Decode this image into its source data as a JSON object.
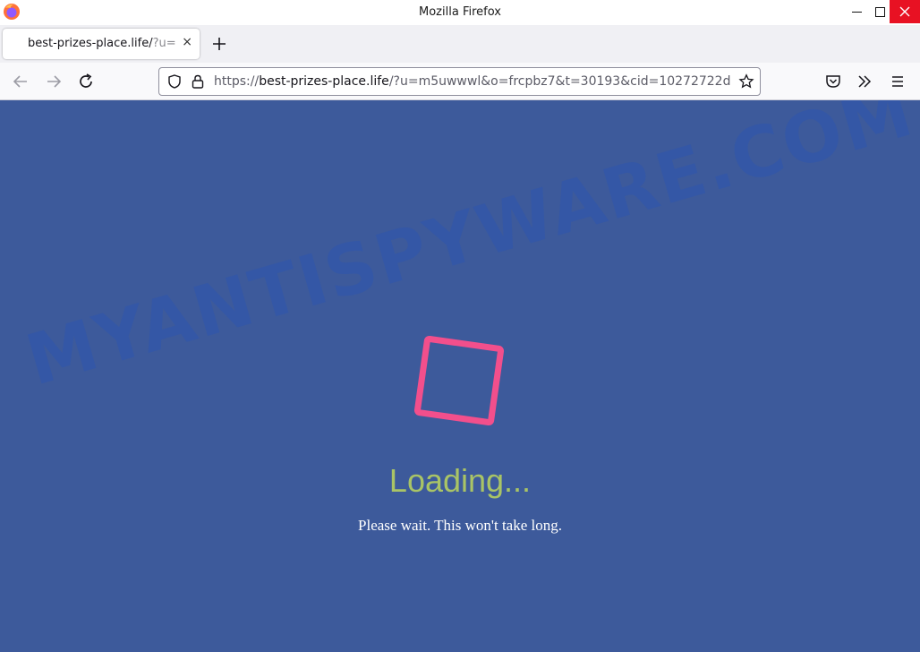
{
  "window": {
    "title": "Mozilla Firefox"
  },
  "tab": {
    "title": "best-prizes-place.life/",
    "title_fade": "?u=",
    "close_glyph": "×"
  },
  "urlbar": {
    "scheme": "https://",
    "host": "best-prizes-place.life",
    "path": "/?u=m5uwwwl&o=frcpbz7&t=30193&cid=10272722d"
  },
  "page": {
    "watermark": "MYANTISPYWARE.COM",
    "loading_text": "Loading...",
    "subtext": "Please wait. This won't take long."
  },
  "colors": {
    "page_bg": "#3d5a9b",
    "spinner": "#f24f8c",
    "loading_text": "#a9c466",
    "close_button": "#e81123"
  },
  "icons": {
    "browser_logo": "firefox-logo",
    "back": "arrow-left-icon",
    "forward": "arrow-right-icon",
    "reload": "reload-icon",
    "shield": "shield-icon",
    "lock": "lock-icon",
    "bookmark": "star-icon",
    "pocket": "pocket-icon",
    "overflow": "chevrons-right-icon",
    "menu": "hamburger-menu-icon"
  }
}
